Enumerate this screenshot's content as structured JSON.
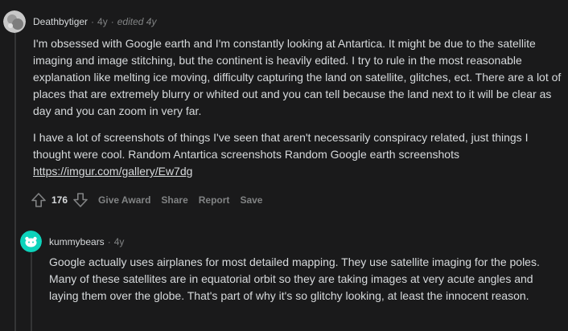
{
  "comment1": {
    "author": "Deathbytiger",
    "age": "4y",
    "edited": "edited 4y",
    "paragraphs": [
      "I'm obsessed with Google earth and I'm constantly looking at Antartica. It might be due to the satellite imaging and image stitching, but the continent is heavily edited. I try to rule in the most reasonable explanation like melting ice moving, difficulty capturing the land on satellite, glitches, ect. There are a lot of places that are extremely blurry or whited out and you can tell because the land next to it will be clear as day and you can zoom in very far.",
      "I have a lot of screenshots of things I've seen that aren't necessarily conspiracy related, just things I thought were cool. Random Antartica screenshots Random Google earth screenshots"
    ],
    "link": "https://imgur.com/gallery/Ew7dg",
    "score": "176",
    "actions": {
      "award": "Give Award",
      "share": "Share",
      "report": "Report",
      "save": "Save"
    }
  },
  "comment2": {
    "author": "kummybears",
    "age": "4y",
    "text": "Google actually uses airplanes for most detailed mapping. They use satellite imaging for the poles. Many of these satellites are in equatorial orbit so they are taking images at very acute angles and laying them over the globe. That's part of why it's so glitchy looking, at least the innocent reason."
  },
  "colors": {
    "background": "#1a1a1b",
    "text": "#d7dadc",
    "muted": "#818384",
    "thread_line": "#343536",
    "avatar2": "#0dd3bb"
  },
  "icons": {
    "upvote": "arrow-up-icon",
    "downvote": "arrow-down-icon"
  },
  "separator": "·"
}
